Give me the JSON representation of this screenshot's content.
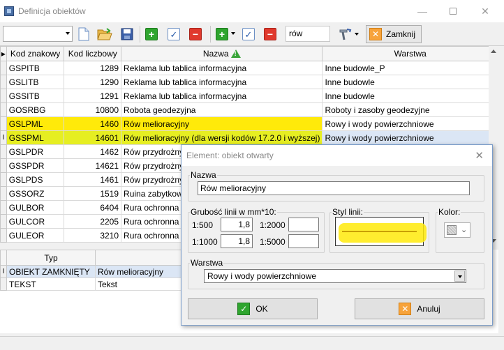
{
  "window": {
    "title": "Definicja obiektów",
    "minimize_icon": "minimize-icon",
    "maximize_icon": "maximize-icon",
    "close_icon": "close-icon"
  },
  "toolbar": {
    "combo_value": "",
    "search_value": "rów",
    "close_label": "Zamknij"
  },
  "main_table": {
    "headers": [
      "Kod znakowy",
      "Kod liczbowy",
      "Nazwa",
      "Warstwa"
    ],
    "rows": [
      [
        "GSPITB",
        "1289",
        "Reklama lub tablica informacyjna",
        "Inne budowle_P"
      ],
      [
        "GSLITB",
        "1290",
        "Reklama lub tablica informacyjna",
        "Inne budowle"
      ],
      [
        "GSSITB",
        "1291",
        "Reklama lub tablica informacyjna",
        "Inne budowle"
      ],
      [
        "GOSRBG",
        "10800",
        "Robota geodezyjna",
        "Roboty i zasoby geodezyjne"
      ],
      [
        "GSLPML",
        "1460",
        "Rów melioracyjny",
        "Rowy i wody powierzchniowe"
      ],
      [
        "GSSPML",
        "14601",
        "Rów melioracyjny (dla wersji kodów 17.2.0 i wyższej)",
        "Rowy i wody powierzchniowe"
      ],
      [
        "GSLPDR",
        "1462",
        "Rów przydrożny",
        ""
      ],
      [
        "GSSPDR",
        "14621",
        "Rów przydrożny",
        ""
      ],
      [
        "GSLPDS",
        "1461",
        "Rów przydrożny",
        ""
      ],
      [
        "GSSORZ",
        "1519",
        "Ruina zabytkowa",
        ""
      ],
      [
        "GULBOR",
        "6404",
        "Rura ochronna p",
        ""
      ],
      [
        "GULCOR",
        "2205",
        "Rura ochronna p",
        ""
      ],
      [
        "GULEOR",
        "3210",
        "Rura ochronna p",
        ""
      ]
    ],
    "current_row_marker": "I"
  },
  "sub_table": {
    "headers": [
      "Typ",
      ""
    ],
    "rows": [
      [
        "OBIEKT ZAMKNIĘTY",
        "Rów melioracyjny"
      ],
      [
        "TEKST",
        "Tekst"
      ]
    ]
  },
  "dialog": {
    "title": "Element: obiekt otwarty",
    "nazwa_legend": "Nazwa",
    "nazwa_value": "Rów melioracyjny",
    "grubosc_legend": "Grubość linii w mm*10:",
    "scale_1_label": "1:500",
    "scale_1_value": "1,8",
    "scale_2_label": "1:2000",
    "scale_2_value": "",
    "scale_3_label": "1:1000",
    "scale_3_value": "1,8",
    "scale_4_label": "1:5000",
    "scale_4_value": "",
    "styl_legend": "Styl linii:",
    "kolor_legend": "Kolor:",
    "warstwa_legend": "Warstwa",
    "warstwa_value": "Rowy i wody powierzchniowe",
    "ok_label": "OK",
    "cancel_label": "Anuluj",
    "line_color": "#c8a000"
  }
}
